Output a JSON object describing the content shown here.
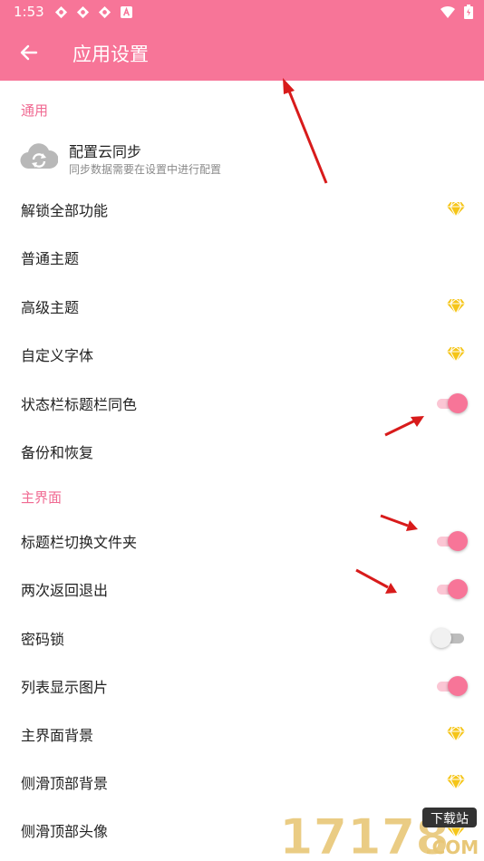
{
  "status_bar": {
    "time": "1:53"
  },
  "app_bar": {
    "title": "应用设置"
  },
  "sections": {
    "general": "通用",
    "main_screen": "主界面"
  },
  "cloud_sync": {
    "title": "配置云同步",
    "subtitle": "同步数据需要在设置中进行配置"
  },
  "settings": [
    {
      "label": "解锁全部功能",
      "control": "premium-gem"
    },
    {
      "label": "普通主题",
      "control": "none"
    },
    {
      "label": "高级主题",
      "control": "premium-gem"
    },
    {
      "label": "自定义字体",
      "control": "premium-gem"
    },
    {
      "label": "状态栏标题栏同色",
      "control": "switch",
      "on": true
    },
    {
      "label": "备份和恢复",
      "control": "none"
    },
    {
      "label": "标题栏切换文件夹",
      "control": "switch",
      "on": true
    },
    {
      "label": "两次返回退出",
      "control": "switch",
      "on": true
    },
    {
      "label": "密码锁",
      "control": "switch",
      "on": false
    },
    {
      "label": "列表显示图片",
      "control": "switch",
      "on": true
    },
    {
      "label": "主界面背景",
      "control": "premium-gem"
    },
    {
      "label": "侧滑顶部背景",
      "control": "premium-gem"
    },
    {
      "label": "侧滑顶部头像",
      "control": "premium-gem"
    }
  ],
  "watermark": {
    "number": "17178",
    "badge": "下载站",
    "domain": ".COM"
  },
  "colors": {
    "accent": "#f77598",
    "section_text": "#f06a92",
    "gem": "#f5c518",
    "annotation_arrow": "#d81b1b"
  }
}
